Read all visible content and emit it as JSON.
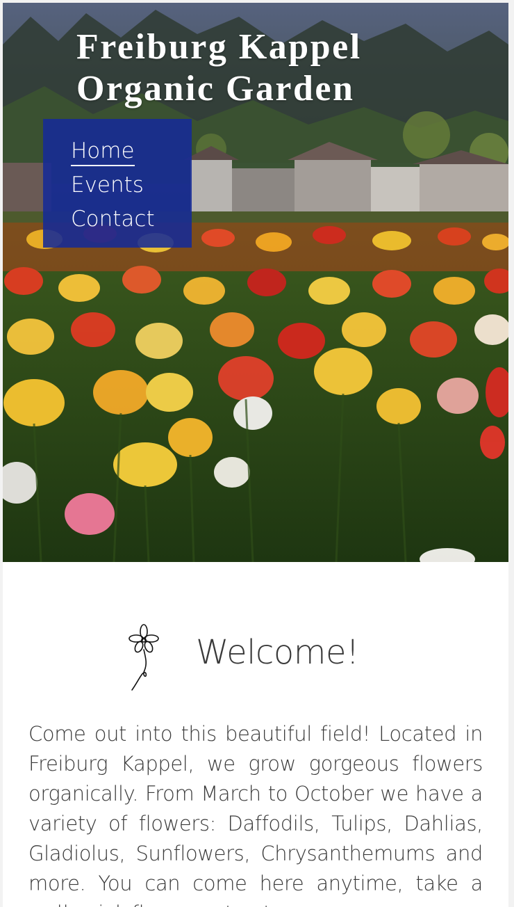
{
  "site": {
    "title": "Freiburg Kappel Organic Garden"
  },
  "nav": {
    "items": [
      {
        "label": "Home",
        "active": true
      },
      {
        "label": "Events",
        "active": false
      },
      {
        "label": "Contact",
        "active": false
      }
    ]
  },
  "hero": {
    "image": "tulip-field-photo"
  },
  "welcome": {
    "icon": "flower-doodle-icon",
    "heading": "Welcome!",
    "text": "Come out into this beautiful field! Located in Freiburg Kappel, we grow gorgeous flowers organically. From March to October we have a variety of flowers: Daffodils, Tulips, Dahlias, Gladiolus, Sunflowers, Chrysanthemums and more. You can come here anytime, take a walk, pick flowers, stop to"
  },
  "colors": {
    "nav_background": "#162a96",
    "heading_text": "#3a3a3a",
    "title_text": "#ffffff"
  }
}
